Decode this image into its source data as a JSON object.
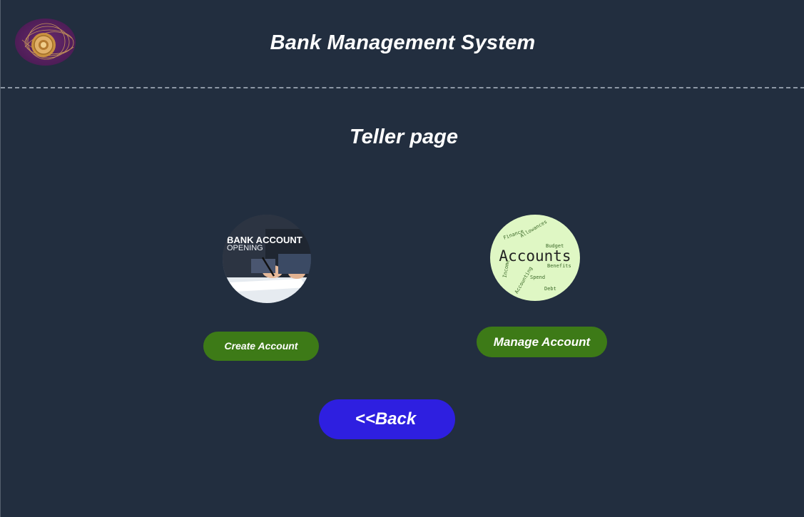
{
  "header": {
    "title": "Bank Management System",
    "logo_icon": "coin-seal-logo-icon"
  },
  "main": {
    "page_title": "Teller page",
    "create": {
      "image_caption_line1": "BANK ACCOUNT",
      "image_caption_line2": "OPENING",
      "button_label": "Create Account"
    },
    "manage": {
      "image_main_word": "Accounts",
      "image_words": [
        "Allowances",
        "Benefits",
        "Budget",
        "Debt",
        "Accounting",
        "Income",
        "Spend",
        "Finance"
      ],
      "button_label": "Manage Account"
    },
    "back_label": "<<Back"
  },
  "colors": {
    "background": "#222e3f",
    "green_button": "#3d7a17",
    "back_button": "#2e1fe0",
    "text": "#ffffff"
  }
}
